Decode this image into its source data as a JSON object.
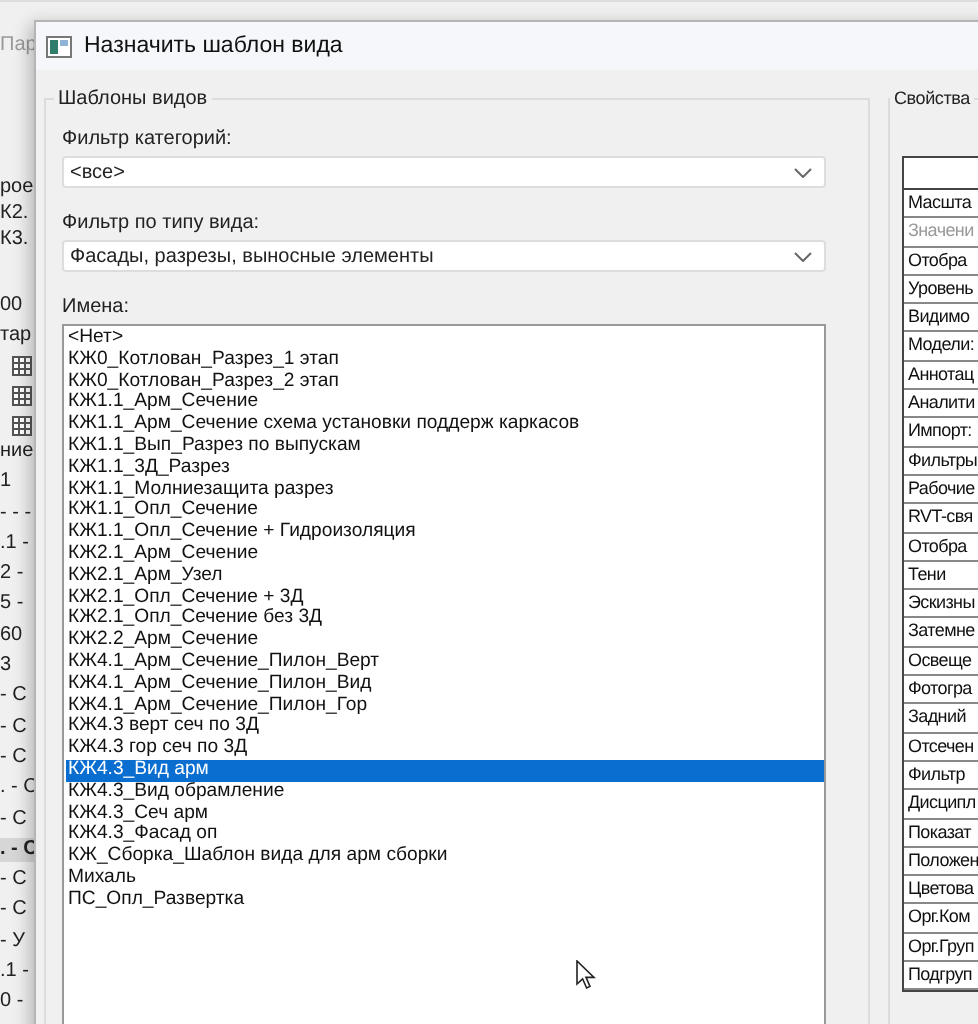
{
  "background_app": {
    "toolbar_label": "Пар",
    "rows_top": [
      {
        "kind": "text",
        "text": "рое"
      },
      {
        "kind": "text",
        "text": "К2."
      },
      {
        "kind": "text",
        "text": "К3."
      }
    ],
    "rows_middle": [
      {
        "kind": "text",
        "text": "00"
      },
      {
        "kind": "text",
        "text": "тар"
      },
      {
        "kind": "table-icon"
      },
      {
        "kind": "table-icon"
      },
      {
        "kind": "table-icon"
      }
    ],
    "rows_bottom": [
      {
        "kind": "text",
        "text": "ние",
        "selected": false
      },
      {
        "kind": "text",
        "text": "1",
        "selected": false
      },
      {
        "kind": "text",
        "text": "- - -",
        "selected": false
      },
      {
        "kind": "text",
        "text": ".1 -",
        "selected": false
      },
      {
        "kind": "text",
        "text": "2 -",
        "selected": false
      },
      {
        "kind": "text",
        "text": "5 -",
        "selected": false
      },
      {
        "kind": "text",
        "text": "60",
        "selected": false
      },
      {
        "kind": "text",
        "text": "3",
        "selected": false
      },
      {
        "kind": "text",
        "text": "- С",
        "selected": false
      },
      {
        "kind": "text",
        "text": "- С",
        "selected": false
      },
      {
        "kind": "text",
        "text": "- С",
        "selected": false
      },
      {
        "kind": "text",
        "text": ". - С",
        "selected": false
      },
      {
        "kind": "text",
        "text": "- С",
        "selected": false
      },
      {
        "kind": "text",
        "text": ". - С",
        "selected": true
      },
      {
        "kind": "text",
        "text": "- С",
        "selected": false
      },
      {
        "kind": "text",
        "text": "- С",
        "selected": false
      },
      {
        "kind": "text",
        "text": "- У",
        "selected": false
      },
      {
        "kind": "text",
        "text": ".1 -",
        "selected": false
      },
      {
        "kind": "text",
        "text": "0 -",
        "selected": false
      }
    ]
  },
  "window": {
    "title": "Назначить шаблон вида"
  },
  "templates_group": {
    "title": "Шаблоны видов",
    "category_filter": {
      "label": "Фильтр категорий:",
      "value": "<все>"
    },
    "view_type_filter": {
      "label": "Фильтр по типу вида:",
      "value": "Фасады, разрезы, выносные элементы"
    },
    "names_label": "Имена:",
    "names": [
      {
        "text": "<Нет>",
        "selected": false
      },
      {
        "text": "КЖ0_Котлован_Разрез_1 этап",
        "selected": false
      },
      {
        "text": "КЖ0_Котлован_Разрез_2 этап",
        "selected": false
      },
      {
        "text": "КЖ1.1_Арм_Сечение",
        "selected": false
      },
      {
        "text": "КЖ1.1_Арм_Сечение схема установки поддерж каркасов",
        "selected": false
      },
      {
        "text": "КЖ1.1_Вып_Разрез по выпускам",
        "selected": false
      },
      {
        "text": "КЖ1.1_3Д_Разрез",
        "selected": false
      },
      {
        "text": "КЖ1.1_Молниезащита разрез",
        "selected": false
      },
      {
        "text": "КЖ1.1_Опл_Сечение",
        "selected": false
      },
      {
        "text": "КЖ1.1_Опл_Сечение + Гидроизоляция",
        "selected": false
      },
      {
        "text": "КЖ2.1_Арм_Сечение",
        "selected": false
      },
      {
        "text": "КЖ2.1_Арм_Узел",
        "selected": false
      },
      {
        "text": "КЖ2.1_Опл_Сечение + 3Д",
        "selected": false
      },
      {
        "text": "КЖ2.1_Опл_Сечение без 3Д",
        "selected": false
      },
      {
        "text": "КЖ2.2_Арм_Сечение",
        "selected": false
      },
      {
        "text": "КЖ4.1_Арм_Сечение_Пилон_Верт",
        "selected": false
      },
      {
        "text": "КЖ4.1_Арм_Сечение_Пилон_Вид",
        "selected": false
      },
      {
        "text": "КЖ4.1_Арм_Сечение_Пилон_Гор",
        "selected": false
      },
      {
        "text": "КЖ4.3 верт сеч по 3Д",
        "selected": false
      },
      {
        "text": "КЖ4.3 гор сеч по 3Д",
        "selected": false
      },
      {
        "text": "КЖ4.3_Вид арм",
        "selected": true
      },
      {
        "text": "КЖ4.3_Вид обрамление",
        "selected": false
      },
      {
        "text": "КЖ4.3_Сеч арм",
        "selected": false
      },
      {
        "text": "КЖ4.3_Фасад оп",
        "selected": false
      },
      {
        "text": "КЖ_Сборка_Шаблон вида для арм сборки",
        "selected": false
      },
      {
        "text": "Михаль",
        "selected": false
      },
      {
        "text": "ПС_Опл_Развертка",
        "selected": false
      }
    ]
  },
  "properties_group": {
    "title": "Свойства",
    "rows": [
      {
        "text": "Масшта",
        "disabled": false
      },
      {
        "text": "Значени",
        "disabled": true
      },
      {
        "text": "Отобра",
        "disabled": false
      },
      {
        "text": "Уровень",
        "disabled": false
      },
      {
        "text": "Видимо",
        "disabled": false
      },
      {
        "text": "Модели:",
        "disabled": false
      },
      {
        "text": "Аннотац",
        "disabled": false
      },
      {
        "text": "Аналити",
        "disabled": false
      },
      {
        "text": "Импорт:",
        "disabled": false
      },
      {
        "text": "Фильтры",
        "disabled": false
      },
      {
        "text": "Рабочие",
        "disabled": false
      },
      {
        "text": "RVT-свя",
        "disabled": false
      },
      {
        "text": "Отобра",
        "disabled": false
      },
      {
        "text": "Тени",
        "disabled": false
      },
      {
        "text": "Эскизны",
        "disabled": false
      },
      {
        "text": "Затемне",
        "disabled": false
      },
      {
        "text": "Освеще",
        "disabled": false
      },
      {
        "text": "Фотогра",
        "disabled": false
      },
      {
        "text": "Задний",
        "disabled": false
      },
      {
        "text": "Отсечен",
        "disabled": false
      },
      {
        "text": "Фильтр",
        "disabled": false
      },
      {
        "text": "Дисципл",
        "disabled": false
      },
      {
        "text": "Показат",
        "disabled": false
      },
      {
        "text": "Положен",
        "disabled": false
      },
      {
        "text": "Цветова",
        "disabled": false
      },
      {
        "text": "Орг.Ком",
        "disabled": false
      },
      {
        "text": "Орг.Груп",
        "disabled": false
      },
      {
        "text": "Подгруп",
        "disabled": false
      }
    ]
  }
}
